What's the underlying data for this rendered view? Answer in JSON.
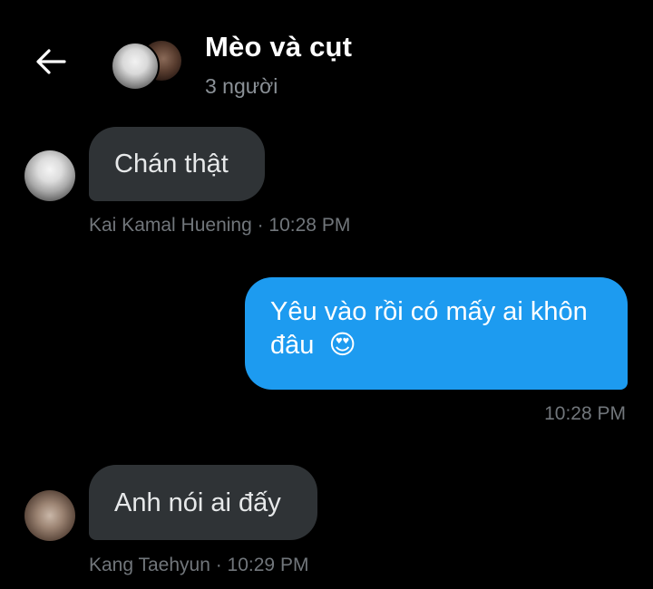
{
  "header": {
    "title": "Mèo và cụt",
    "subtitle": "3 người",
    "back_icon": "arrow-left-icon"
  },
  "messages": [
    {
      "direction": "incoming",
      "text": "Chán thật",
      "sender": "Kai Kamal Huening",
      "time": "10:28 PM",
      "meta": "Kai Kamal Huening · 10:28 PM"
    },
    {
      "direction": "outgoing",
      "text": "Yêu vào rồi có mấy ai khôn đâu",
      "emoji": "😍",
      "time": "10:28 PM",
      "meta": "10:28 PM"
    },
    {
      "direction": "incoming",
      "text": "Anh nói ai đấy",
      "sender": "Kang Taehyun",
      "time": "10:29 PM",
      "meta": "Kang Taehyun · 10:29 PM"
    }
  ],
  "colors": {
    "background": "#000000",
    "incoming_bubble": "#2f3336",
    "outgoing_bubble": "#1d9bf0",
    "meta_text": "#71767b"
  }
}
